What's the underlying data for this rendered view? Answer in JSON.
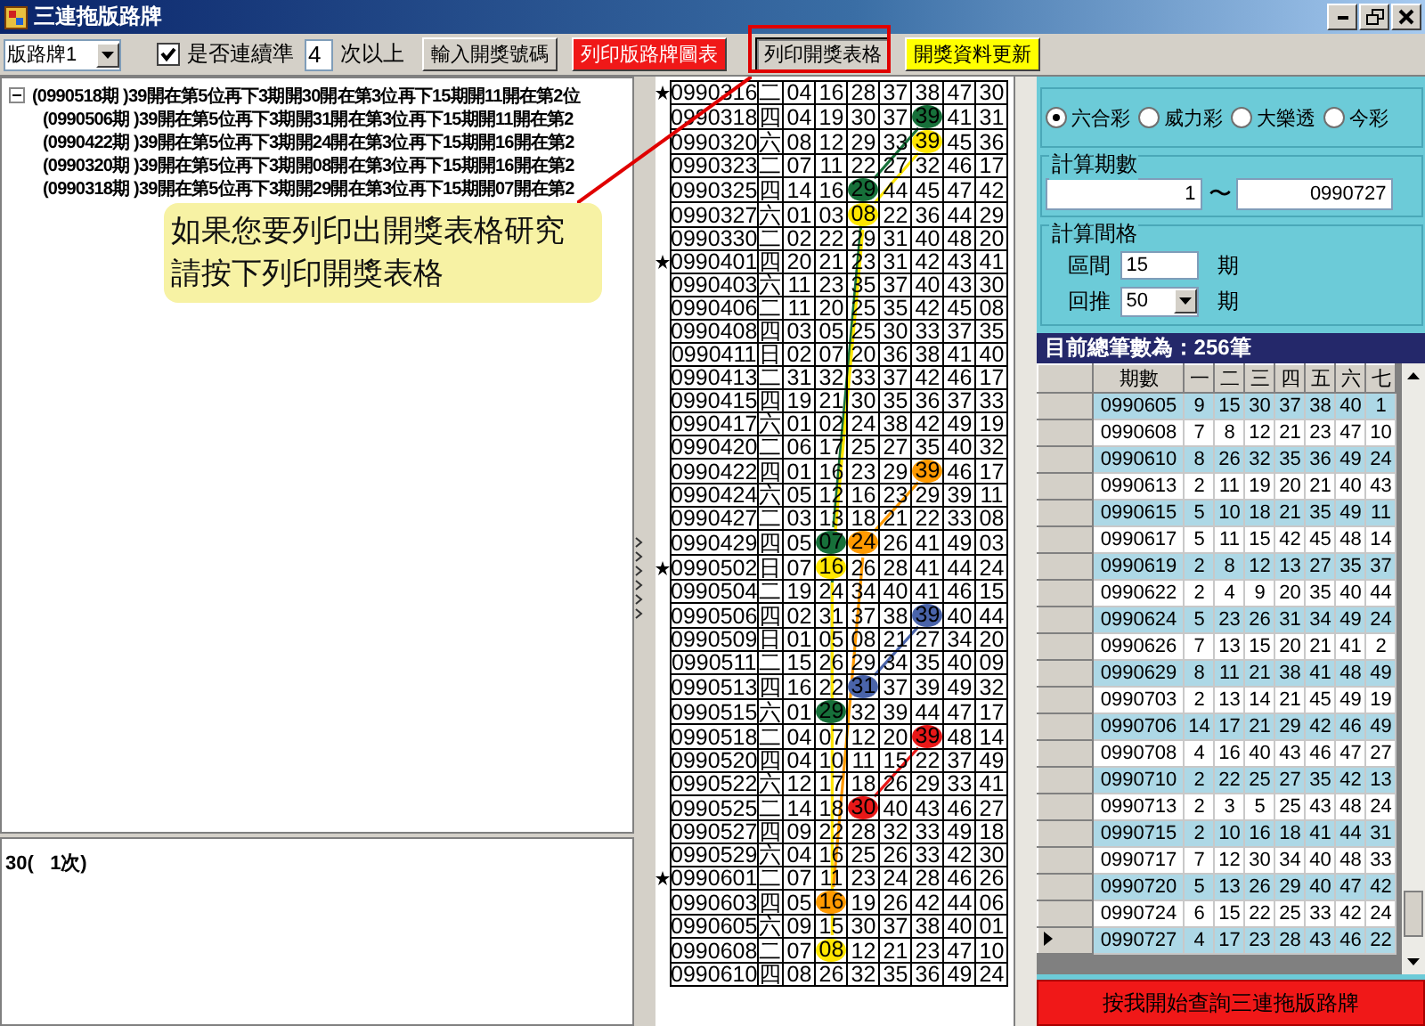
{
  "window": {
    "title": "三連拖版路牌"
  },
  "toolbar": {
    "chart_select": {
      "value": "版路牌1"
    },
    "consecutive": {
      "label": "是否連續準",
      "checked": true
    },
    "times": {
      "value": "4"
    },
    "times_suffix": "次以上",
    "buttons": [
      {
        "label": "輸入開獎號碼",
        "kind": "plain",
        "pressed": false
      },
      {
        "label": "列印版路牌圖表",
        "kind": "red",
        "pressed": false
      },
      {
        "label": "列印開獎表格",
        "kind": "plain",
        "pressed": true
      },
      {
        "label": "開獎資料更新",
        "kind": "yellow",
        "pressed": false
      }
    ]
  },
  "tree": [
    {
      "label": "(0990518期 )39開在第5位再下3期開30開在第3位再下15期開11開在第2位",
      "expanded": true,
      "children": [
        {
          "label": "(0990506期 )39開在第5位再下3期開31開在第3位再下15期開11開在第2"
        },
        {
          "label": "(0990422期 )39開在第5位再下3期開24開在第3位再下15期開16開在第2"
        },
        {
          "label": "(0990320期 )39開在第5位再下3期開08開在第3位再下15期開16開在第2"
        },
        {
          "label": "(0990318期 )39開在第5位再下3期開29開在第3位再下15期開07開在第2"
        }
      ]
    }
  ],
  "result_text": "30(   1次)",
  "callout": {
    "lines": [
      "如果您要列印出開獎表格研究",
      "請按下列印開獎表格"
    ]
  },
  "grid": {
    "rows": [
      {
        "date": "0990316",
        "weekday": "二",
        "starred": true,
        "numbers": [
          "04",
          "16",
          "28",
          "37",
          "38",
          "47",
          "30"
        ]
      },
      {
        "date": "0990318",
        "weekday": "四",
        "starred": false,
        "numbers": [
          "04",
          "19",
          "30",
          "37",
          {
            "value": "39",
            "color": "#17703a"
          },
          "41",
          "31"
        ]
      },
      {
        "date": "0990320",
        "weekday": "六",
        "starred": false,
        "numbers": [
          "08",
          "12",
          "29",
          "33",
          {
            "value": "39",
            "color": "#ffe600"
          },
          "45",
          "36"
        ]
      },
      {
        "date": "0990323",
        "weekday": "二",
        "starred": false,
        "numbers": [
          "07",
          "11",
          "22",
          "27",
          "32",
          "46",
          "17"
        ]
      },
      {
        "date": "0990325",
        "weekday": "四",
        "starred": false,
        "numbers": [
          "14",
          "16",
          {
            "value": "29",
            "color": "#17703a"
          },
          "44",
          "45",
          "47",
          "42"
        ]
      },
      {
        "date": "0990327",
        "weekday": "六",
        "starred": false,
        "numbers": [
          "01",
          "03",
          {
            "value": "08",
            "color": "#ffe600"
          },
          "22",
          "36",
          "44",
          "29"
        ]
      },
      {
        "date": "0990330",
        "weekday": "二",
        "starred": false,
        "numbers": [
          "02",
          "22",
          "29",
          "31",
          "40",
          "48",
          "20"
        ]
      },
      {
        "date": "0990401",
        "weekday": "四",
        "starred": true,
        "numbers": [
          "20",
          "21",
          "23",
          "31",
          "42",
          "43",
          "41"
        ]
      },
      {
        "date": "0990403",
        "weekday": "六",
        "starred": false,
        "numbers": [
          "11",
          "23",
          "35",
          "37",
          "40",
          "43",
          "30"
        ]
      },
      {
        "date": "0990406",
        "weekday": "二",
        "starred": false,
        "numbers": [
          "11",
          "20",
          "25",
          "35",
          "42",
          "45",
          "08"
        ]
      },
      {
        "date": "0990408",
        "weekday": "四",
        "starred": false,
        "numbers": [
          "03",
          "05",
          "25",
          "30",
          "33",
          "37",
          "35"
        ]
      },
      {
        "date": "0990411",
        "weekday": "日",
        "starred": false,
        "numbers": [
          "02",
          "07",
          "20",
          "36",
          "38",
          "41",
          "40"
        ]
      },
      {
        "date": "0990413",
        "weekday": "二",
        "starred": false,
        "numbers": [
          "31",
          "32",
          "33",
          "37",
          "42",
          "46",
          "17"
        ]
      },
      {
        "date": "0990415",
        "weekday": "四",
        "starred": false,
        "numbers": [
          "19",
          "21",
          "30",
          "35",
          "36",
          "37",
          "33"
        ]
      },
      {
        "date": "0990417",
        "weekday": "六",
        "starred": false,
        "numbers": [
          "01",
          "02",
          "24",
          "38",
          "42",
          "49",
          "19"
        ]
      },
      {
        "date": "0990420",
        "weekday": "二",
        "starred": false,
        "numbers": [
          "06",
          "17",
          "25",
          "27",
          "35",
          "40",
          "32"
        ]
      },
      {
        "date": "0990422",
        "weekday": "四",
        "starred": false,
        "numbers": [
          "01",
          "16",
          "23",
          "29",
          {
            "value": "39",
            "color": "#ff9a00"
          },
          "46",
          "17"
        ]
      },
      {
        "date": "0990424",
        "weekday": "六",
        "starred": false,
        "numbers": [
          "05",
          "12",
          "16",
          "23",
          "29",
          "39",
          "11"
        ]
      },
      {
        "date": "0990427",
        "weekday": "二",
        "starred": false,
        "numbers": [
          "03",
          "13",
          "18",
          "21",
          "22",
          "33",
          "08"
        ]
      },
      {
        "date": "0990429",
        "weekday": "四",
        "starred": false,
        "numbers": [
          "05",
          {
            "value": "07",
            "color": "#17703a"
          },
          {
            "value": "24",
            "color": "#ff9a00"
          },
          "26",
          "41",
          "49",
          "03"
        ]
      },
      {
        "date": "0990502",
        "weekday": "日",
        "starred": true,
        "numbers": [
          "07",
          {
            "value": "16",
            "color": "#ffe600"
          },
          "26",
          "28",
          "41",
          "44",
          "24"
        ]
      },
      {
        "date": "0990504",
        "weekday": "二",
        "starred": false,
        "numbers": [
          "19",
          "24",
          "34",
          "40",
          "41",
          "46",
          "15"
        ]
      },
      {
        "date": "0990506",
        "weekday": "四",
        "starred": false,
        "numbers": [
          "02",
          "31",
          "37",
          "38",
          {
            "value": "39",
            "color": "#4a64aa"
          },
          "40",
          "44"
        ]
      },
      {
        "date": "0990509",
        "weekday": "日",
        "starred": false,
        "numbers": [
          "01",
          "05",
          "08",
          "21",
          "27",
          "34",
          "20"
        ]
      },
      {
        "date": "0990511",
        "weekday": "二",
        "starred": false,
        "numbers": [
          "15",
          "26",
          "29",
          "34",
          "35",
          "40",
          "09"
        ]
      },
      {
        "date": "0990513",
        "weekday": "四",
        "starred": false,
        "numbers": [
          "16",
          "22",
          {
            "value": "31",
            "color": "#4a64aa"
          },
          "37",
          "39",
          "49",
          "32"
        ]
      },
      {
        "date": "0990515",
        "weekday": "六",
        "starred": false,
        "numbers": [
          "01",
          {
            "value": "29",
            "color": "#17703a"
          },
          "32",
          "39",
          "44",
          "47",
          "17"
        ]
      },
      {
        "date": "0990518",
        "weekday": "二",
        "starred": false,
        "numbers": [
          "04",
          "07",
          "12",
          "20",
          {
            "value": "39",
            "color": "#e81818"
          },
          "48",
          "14"
        ]
      },
      {
        "date": "0990520",
        "weekday": "四",
        "starred": false,
        "numbers": [
          "04",
          "10",
          "11",
          "15",
          "22",
          "37",
          "49"
        ]
      },
      {
        "date": "0990522",
        "weekday": "六",
        "starred": false,
        "numbers": [
          "12",
          "17",
          "18",
          "26",
          "29",
          "33",
          "41"
        ]
      },
      {
        "date": "0990525",
        "weekday": "二",
        "starred": false,
        "numbers": [
          "14",
          "18",
          {
            "value": "30",
            "color": "#e81818"
          },
          "40",
          "43",
          "46",
          "27"
        ]
      },
      {
        "date": "0990527",
        "weekday": "四",
        "starred": false,
        "numbers": [
          "09",
          "22",
          "28",
          "32",
          "33",
          "49",
          "18"
        ]
      },
      {
        "date": "0990529",
        "weekday": "六",
        "starred": false,
        "numbers": [
          "04",
          "16",
          "25",
          "26",
          "33",
          "42",
          "30"
        ]
      },
      {
        "date": "0990601",
        "weekday": "二",
        "starred": true,
        "numbers": [
          "07",
          "11",
          "23",
          "24",
          "28",
          "46",
          "26"
        ]
      },
      {
        "date": "0990603",
        "weekday": "四",
        "starred": false,
        "numbers": [
          "05",
          {
            "value": "16",
            "color": "#ff9a00"
          },
          "19",
          "26",
          "42",
          "44",
          "06"
        ]
      },
      {
        "date": "0990605",
        "weekday": "六",
        "starred": false,
        "numbers": [
          "09",
          "15",
          "30",
          "37",
          "38",
          "40",
          "01"
        ]
      },
      {
        "date": "0990608",
        "weekday": "二",
        "starred": false,
        "numbers": [
          "07",
          {
            "value": "08",
            "color": "#ffe600"
          },
          "12",
          "21",
          "23",
          "47",
          "10"
        ]
      },
      {
        "date": "0990610",
        "weekday": "四",
        "starred": false,
        "numbers": [
          "08",
          "26",
          "32",
          "35",
          "36",
          "49",
          "24"
        ]
      }
    ]
  },
  "lottery_types": [
    {
      "label": "六合彩",
      "selected": true
    },
    {
      "label": "威力彩",
      "selected": false
    },
    {
      "label": "大樂透",
      "selected": false
    },
    {
      "label": "今彩",
      "selected": false
    }
  ],
  "period_range": {
    "title": "計算期數",
    "from": "1",
    "separator": "〜",
    "to": "0990727"
  },
  "interval": {
    "title": "計算間格",
    "span_label": "區間",
    "span_value": "15",
    "span_unit": "期",
    "back_label": "回推",
    "back_value": "50",
    "back_unit": "期"
  },
  "total_label": "目前總筆數為：256筆",
  "results": {
    "columns": [
      "期數",
      "一",
      "二",
      "三",
      "四",
      "五",
      "六",
      "七"
    ],
    "rows": [
      {
        "current": false,
        "cells": [
          "0990605",
          "9",
          "15",
          "30",
          "37",
          "38",
          "40",
          "1"
        ]
      },
      {
        "current": false,
        "cells": [
          "0990608",
          "7",
          "8",
          "12",
          "21",
          "23",
          "47",
          "10"
        ]
      },
      {
        "current": false,
        "cells": [
          "0990610",
          "8",
          "26",
          "32",
          "35",
          "36",
          "49",
          "24"
        ]
      },
      {
        "current": false,
        "cells": [
          "0990613",
          "2",
          "11",
          "19",
          "20",
          "21",
          "40",
          "43"
        ]
      },
      {
        "current": false,
        "cells": [
          "0990615",
          "5",
          "10",
          "18",
          "21",
          "35",
          "49",
          "11"
        ]
      },
      {
        "current": false,
        "cells": [
          "0990617",
          "5",
          "11",
          "15",
          "42",
          "45",
          "48",
          "14"
        ]
      },
      {
        "current": false,
        "cells": [
          "0990619",
          "2",
          "8",
          "12",
          "13",
          "27",
          "35",
          "37"
        ]
      },
      {
        "current": false,
        "cells": [
          "0990622",
          "2",
          "4",
          "9",
          "20",
          "35",
          "40",
          "44"
        ]
      },
      {
        "current": false,
        "cells": [
          "0990624",
          "5",
          "23",
          "26",
          "31",
          "34",
          "49",
          "24"
        ]
      },
      {
        "current": false,
        "cells": [
          "0990626",
          "7",
          "13",
          "15",
          "20",
          "21",
          "41",
          "2"
        ]
      },
      {
        "current": false,
        "cells": [
          "0990629",
          "8",
          "11",
          "21",
          "38",
          "41",
          "48",
          "49"
        ]
      },
      {
        "current": false,
        "cells": [
          "0990703",
          "2",
          "13",
          "14",
          "21",
          "45",
          "49",
          "19"
        ]
      },
      {
        "current": false,
        "cells": [
          "0990706",
          "14",
          "17",
          "21",
          "29",
          "42",
          "46",
          "49"
        ]
      },
      {
        "current": false,
        "cells": [
          "0990708",
          "4",
          "16",
          "40",
          "43",
          "46",
          "47",
          "27"
        ]
      },
      {
        "current": false,
        "cells": [
          "0990710",
          "2",
          "22",
          "25",
          "27",
          "35",
          "42",
          "13"
        ]
      },
      {
        "current": false,
        "cells": [
          "0990713",
          "2",
          "3",
          "5",
          "25",
          "43",
          "48",
          "24"
        ]
      },
      {
        "current": false,
        "cells": [
          "0990715",
          "2",
          "10",
          "16",
          "18",
          "41",
          "44",
          "31"
        ]
      },
      {
        "current": false,
        "cells": [
          "0990717",
          "7",
          "12",
          "30",
          "34",
          "40",
          "48",
          "33"
        ]
      },
      {
        "current": false,
        "cells": [
          "0990720",
          "5",
          "13",
          "26",
          "29",
          "40",
          "47",
          "42"
        ]
      },
      {
        "current": false,
        "cells": [
          "0990724",
          "6",
          "15",
          "22",
          "25",
          "33",
          "42",
          "24"
        ]
      },
      {
        "current": true,
        "cells": [
          "0990727",
          "4",
          "17",
          "23",
          "28",
          "43",
          "46",
          "22"
        ]
      }
    ]
  },
  "query_button": "按我開始查詢三連拖版路牌"
}
